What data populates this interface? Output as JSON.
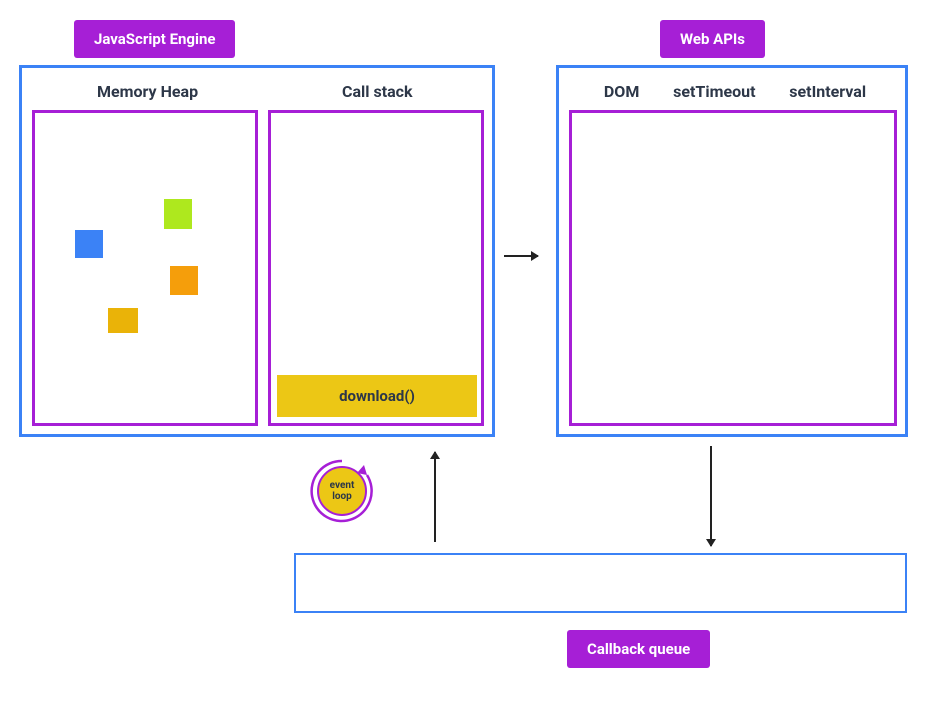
{
  "titles": {
    "js_engine": "JavaScript Engine",
    "web_apis": "Web APIs",
    "callback_queue": "Callback queue"
  },
  "headings": {
    "memory_heap": "Memory Heap",
    "call_stack": "Call stack"
  },
  "web_apis_list": {
    "dom": "DOM",
    "set_timeout": "setTimeout",
    "set_interval": "setInterval"
  },
  "call_stack_items": {
    "download": "download()"
  },
  "event_loop": {
    "line1": "event",
    "line2": "loop"
  },
  "colors": {
    "accent": "#a61fd6",
    "blue_border": "#3b82f6",
    "yellow": "#ecc715",
    "heap_blue": "#3b82f6",
    "heap_green": "#aee81e",
    "heap_orange": "#f59e0b",
    "heap_yellow": "#eab308"
  }
}
